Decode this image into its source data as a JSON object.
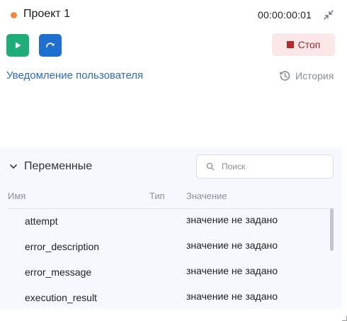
{
  "header": {
    "project_title": "Проект 1",
    "timer": "00:00:00:01",
    "status_color": "#f0883e"
  },
  "toolbar": {
    "play_icon": "play-icon",
    "step_icon": "step-over-icon",
    "stop_label": "Стоп"
  },
  "notification": {
    "link_text": "Уведомление пользователя"
  },
  "history": {
    "label": "История"
  },
  "variables": {
    "title": "Переменные",
    "search_placeholder": "Поиск",
    "columns": {
      "name": "Имя",
      "type": "Тип",
      "value": "Значение"
    },
    "rows": [
      {
        "name": "attempt",
        "type": "",
        "value": "значение не задано"
      },
      {
        "name": "error_description",
        "type": "",
        "value": "значение не задано"
      },
      {
        "name": "error_message",
        "type": "",
        "value": "значение не задано"
      },
      {
        "name": "execution_result",
        "type": "",
        "value": "значение не задано"
      }
    ]
  },
  "colors": {
    "play": "#1fae7a",
    "step": "#1f6fd1",
    "stop_bg": "#fbe7e7",
    "stop_fg": "#a52626",
    "link": "#2a6cc8"
  }
}
